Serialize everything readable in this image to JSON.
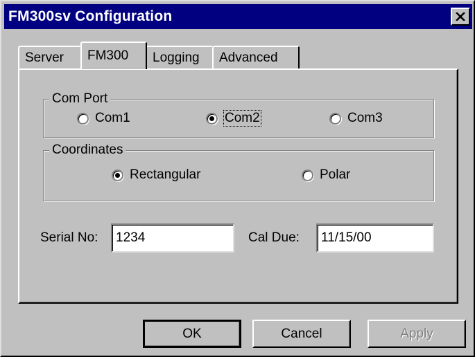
{
  "window": {
    "title": "FM300sv Configuration",
    "close_icon": "close-icon"
  },
  "tabs": [
    {
      "label": "Server",
      "active": false
    },
    {
      "label": "FM300",
      "active": true
    },
    {
      "label": "Logging",
      "active": false
    },
    {
      "label": "Advanced",
      "active": false
    }
  ],
  "com_port": {
    "label": "Com Port",
    "options": [
      {
        "label": "Com1",
        "selected": false
      },
      {
        "label": "Com2",
        "selected": true
      },
      {
        "label": "Com3",
        "selected": false
      }
    ]
  },
  "coordinates": {
    "label": "Coordinates",
    "options": [
      {
        "label": "Rectangular",
        "selected": true
      },
      {
        "label": "Polar",
        "selected": false
      }
    ]
  },
  "serial": {
    "label": "Serial No:",
    "value": "1234"
  },
  "cal_due": {
    "label": "Cal Due:",
    "value": "11/15/00"
  },
  "buttons": {
    "ok": "OK",
    "cancel": "Cancel",
    "apply": "Apply"
  },
  "colors": {
    "titlebar": "#000080",
    "face": "#c0c0c0",
    "disabled_text": "#808080"
  }
}
